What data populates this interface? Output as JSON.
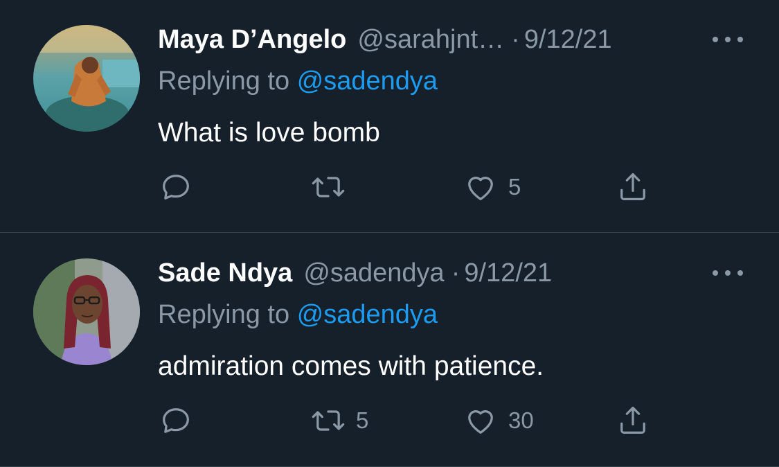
{
  "colors": {
    "background": "#15202b",
    "divider": "#38444d",
    "text_primary": "#ffffff",
    "text_secondary": "#8b98a5",
    "accent": "#1d9bf0"
  },
  "tweets": [
    {
      "display_name": "Maya D’Angelo",
      "handle": "@sarahjnt…",
      "separator": "·",
      "date": "9/12/21",
      "replying_prefix": "Replying to",
      "replying_to": "@sadendya",
      "text": "What is love bomb",
      "reply_count": "",
      "retweet_count": "",
      "like_count": "5",
      "icons": [
        "reply-icon",
        "retweet-icon",
        "like-icon",
        "share-icon",
        "more-icon"
      ]
    },
    {
      "display_name": "Sade Ndya",
      "handle": "@sadendya",
      "separator": "·",
      "date": "9/12/21",
      "replying_prefix": "Replying to",
      "replying_to": "@sadendya",
      "text": "admiration comes with patience.",
      "reply_count": "",
      "retweet_count": "5",
      "like_count": "30",
      "icons": [
        "reply-icon",
        "retweet-icon",
        "like-icon",
        "share-icon",
        "more-icon"
      ]
    }
  ]
}
